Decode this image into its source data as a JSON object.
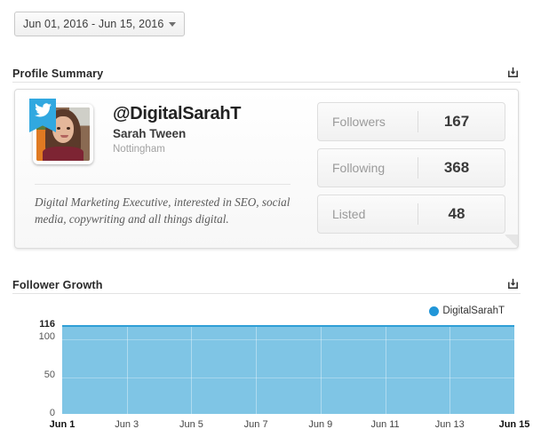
{
  "daterange": {
    "label": "Jun 01, 2016 - Jun 15, 2016",
    "caret_icon": "chevron-down-icon"
  },
  "sections": {
    "profile_summary": {
      "title": "Profile Summary",
      "export_icon": "export-download-icon"
    },
    "follower_growth": {
      "title": "Follower Growth",
      "export_icon": "export-download-icon"
    }
  },
  "profile": {
    "network_icon": "twitter-bird-icon",
    "avatar_alt": "profile-photo",
    "handle": "@DigitalSarahT",
    "full_name": "Sarah Tween",
    "location": "Nottingham",
    "bio": "Digital Marketing Executive, interested in SEO, social media, copywriting and all things digital.",
    "stats": [
      {
        "label": "Followers",
        "value": "167"
      },
      {
        "label": "Following",
        "value": "368"
      },
      {
        "label": "Listed",
        "value": "48"
      }
    ]
  },
  "colors": {
    "area_fill": "#7fc5e5",
    "area_line": "#2f9fd6",
    "legend_dot": "#2196d8",
    "twitter_blue": "#31a8e0"
  },
  "chart_data": {
    "type": "area",
    "title": "Follower Growth",
    "xlabel": "",
    "ylabel": "",
    "legend": [
      "DigitalSarahT"
    ],
    "legend_position": "top-right",
    "grid": true,
    "ylim": [
      0,
      116
    ],
    "yticks": [
      "0",
      "50",
      "100",
      "116"
    ],
    "xticks": [
      "Jun 1",
      "Jun 3",
      "Jun 5",
      "Jun 7",
      "Jun 9",
      "Jun 11",
      "Jun 13",
      "Jun 15"
    ],
    "x": [
      "Jun 1",
      "Jun 2",
      "Jun 3",
      "Jun 4",
      "Jun 5",
      "Jun 6",
      "Jun 7",
      "Jun 8",
      "Jun 9",
      "Jun 10",
      "Jun 11",
      "Jun 12",
      "Jun 13",
      "Jun 14",
      "Jun 15"
    ],
    "series": [
      {
        "name": "DigitalSarahT",
        "values": [
          116,
          116,
          116,
          116,
          116,
          116,
          116,
          116,
          116,
          116,
          116,
          116,
          116,
          116,
          116
        ]
      }
    ]
  }
}
